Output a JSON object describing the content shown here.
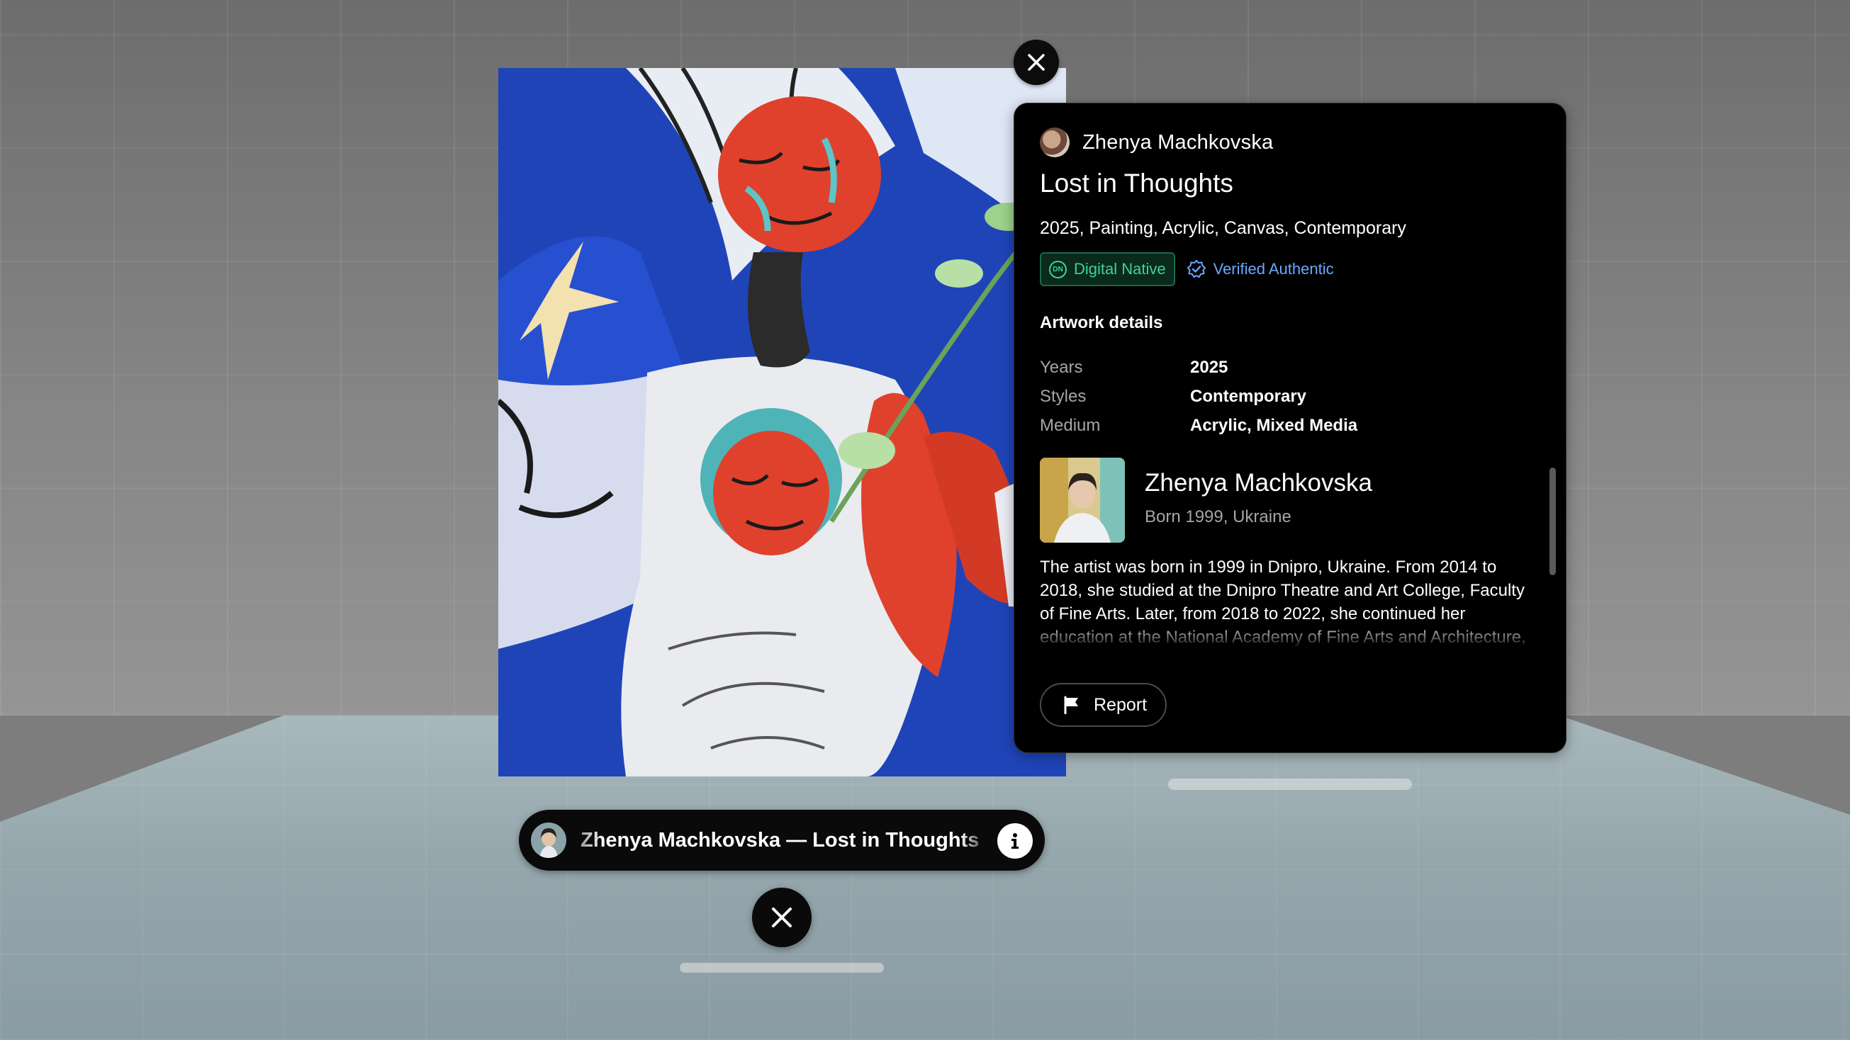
{
  "artwork": {
    "author": "Zhenya Machkovska",
    "title": "Lost in Thoughts",
    "meta": "2025, Painting, Acrylic, Canvas, Contemporary",
    "badges": {
      "digital_native": "Digital Native",
      "digital_native_icon_text": "DN",
      "verified": "Verified Authentic"
    },
    "details_title": "Artwork details",
    "details": [
      {
        "key": "Years",
        "value": "2025"
      },
      {
        "key": "Styles",
        "value": "Contemporary"
      },
      {
        "key": "Medium",
        "value": "Acrylic, Mixed Media"
      }
    ]
  },
  "artist": {
    "name": "Zhenya Machkovska",
    "born": "Born 1999, Ukraine",
    "bio": "The artist was born in 1999 in Dnipro, Ukraine. From 2014 to 2018, she studied at the Dnipro Theatre and Art College, Faculty of Fine Arts. Later, from 2018 to 2022, she continued her education at the National Academy of Fine Arts and Architecture, Faculty of Fine Arts and Restoration."
  },
  "actions": {
    "report_label": "Report"
  },
  "caption": {
    "text": "Zhenya Machkovska — Lost in Thoughts"
  },
  "colors": {
    "panel_bg": "#000000",
    "native_badge": "#3fd19a",
    "verified": "#6aa9ff",
    "painting_blue": "#1f44b8",
    "painting_red": "#e0412c"
  },
  "icons": {
    "close": "close-icon",
    "info": "info-icon",
    "flag": "flag-icon",
    "verified": "verified-check-icon"
  }
}
